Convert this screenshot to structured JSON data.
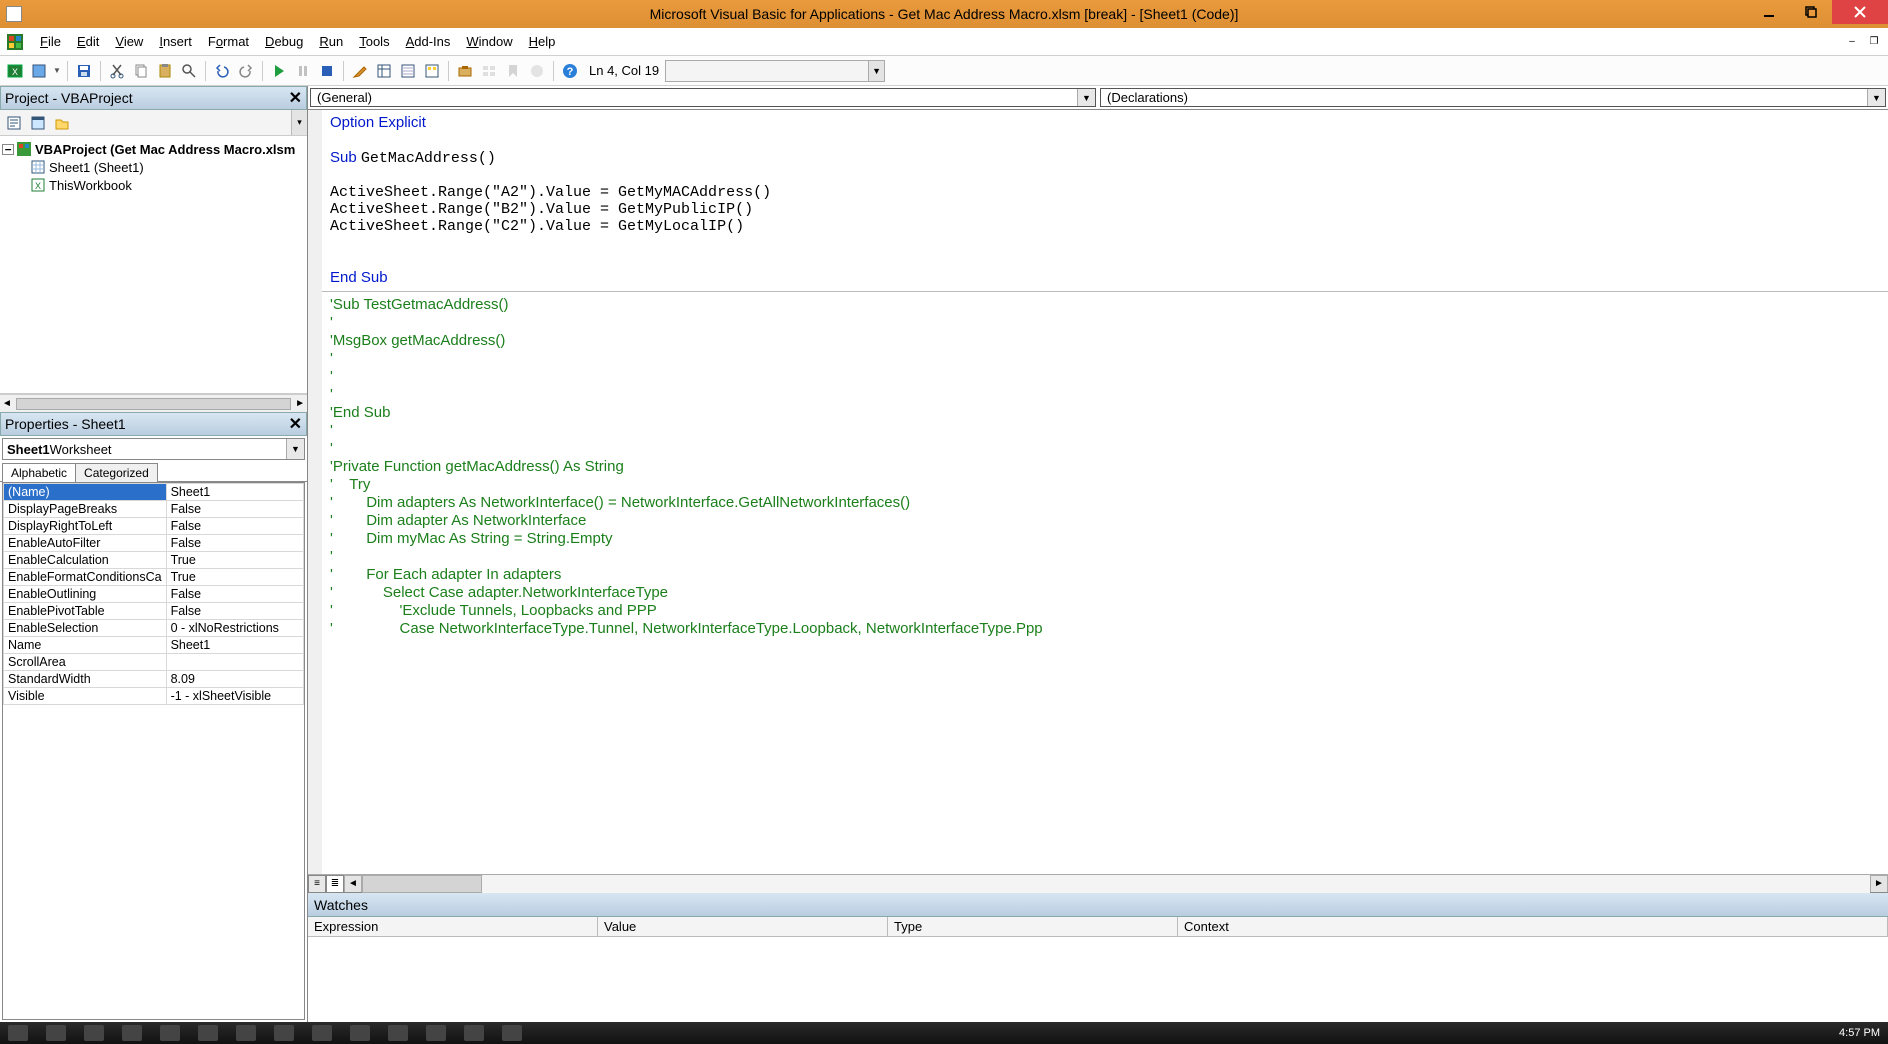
{
  "title": "Microsoft Visual Basic for Applications - Get Mac Address Macro.xlsm [break] - [Sheet1 (Code)]",
  "menu": {
    "file": "File",
    "edit": "Edit",
    "view": "View",
    "insert": "Insert",
    "format": "Format",
    "debug": "Debug",
    "run": "Run",
    "tools": "Tools",
    "addins": "Add-Ins",
    "window": "Window",
    "help": "Help"
  },
  "cursor_pos": "Ln 4, Col 19",
  "project": {
    "panel_title": "Project - VBAProject",
    "root": "VBAProject (Get Mac Address Macro.xlsm",
    "items": [
      "Sheet1 (Sheet1)",
      "ThisWorkbook"
    ]
  },
  "properties": {
    "panel_title": "Properties - Sheet1",
    "combo_bold": "Sheet1",
    "combo_rest": " Worksheet",
    "tabs": {
      "alpha": "Alphabetic",
      "cat": "Categorized"
    },
    "rows": [
      {
        "name": "(Name)",
        "value": "Sheet1",
        "sel": true
      },
      {
        "name": "DisplayPageBreaks",
        "value": "False"
      },
      {
        "name": "DisplayRightToLeft",
        "value": "False"
      },
      {
        "name": "EnableAutoFilter",
        "value": "False"
      },
      {
        "name": "EnableCalculation",
        "value": "True"
      },
      {
        "name": "EnableFormatConditionsCa",
        "value": "True"
      },
      {
        "name": "EnableOutlining",
        "value": "False"
      },
      {
        "name": "EnablePivotTable",
        "value": "False"
      },
      {
        "name": "EnableSelection",
        "value": "0 - xlNoRestrictions"
      },
      {
        "name": "Name",
        "value": "Sheet1"
      },
      {
        "name": "ScrollArea",
        "value": ""
      },
      {
        "name": "StandardWidth",
        "value": "8.09"
      },
      {
        "name": "Visible",
        "value": "-1 - xlSheetVisible"
      }
    ]
  },
  "code": {
    "object_combo": "(General)",
    "proc_combo": "(Declarations)",
    "lines": [
      {
        "t": "Option Explicit",
        "c": "kw"
      },
      {
        "t": "",
        "c": ""
      },
      {
        "seg": [
          {
            "t": "Sub ",
            "c": "kw"
          },
          {
            "t": "GetMacAddress()",
            "c": ""
          }
        ]
      },
      {
        "t": "",
        "c": ""
      },
      {
        "t": "ActiveSheet.Range(\"A2\").Value = GetMyMACAddress()",
        "c": ""
      },
      {
        "t": "ActiveSheet.Range(\"B2\").Value = GetMyPublicIP()",
        "c": ""
      },
      {
        "t": "ActiveSheet.Range(\"C2\").Value = GetMyLocalIP()",
        "c": ""
      },
      {
        "t": "",
        "c": ""
      },
      {
        "t": "",
        "c": ""
      },
      {
        "t": "End Sub",
        "c": "kw"
      },
      {
        "rule": true
      },
      {
        "t": "'Sub TestGetmacAddress()",
        "c": "cm"
      },
      {
        "t": "'",
        "c": "cm"
      },
      {
        "t": "'MsgBox getMacAddress()",
        "c": "cm"
      },
      {
        "t": "'",
        "c": "cm"
      },
      {
        "t": "'",
        "c": "cm"
      },
      {
        "t": "'",
        "c": "cm"
      },
      {
        "t": "'End Sub",
        "c": "cm"
      },
      {
        "t": "'",
        "c": "cm"
      },
      {
        "t": "'",
        "c": "cm"
      },
      {
        "t": "'Private Function getMacAddress() As String",
        "c": "cm"
      },
      {
        "t": "'    Try",
        "c": "cm"
      },
      {
        "t": "'        Dim adapters As NetworkInterface() = NetworkInterface.GetAllNetworkInterfaces()",
        "c": "cm"
      },
      {
        "t": "'        Dim adapter As NetworkInterface",
        "c": "cm"
      },
      {
        "t": "'        Dim myMac As String = String.Empty",
        "c": "cm"
      },
      {
        "t": "'",
        "c": "cm"
      },
      {
        "t": "'        For Each adapter In adapters",
        "c": "cm"
      },
      {
        "t": "'            Select Case adapter.NetworkInterfaceType",
        "c": "cm"
      },
      {
        "t": "'                'Exclude Tunnels, Loopbacks and PPP",
        "c": "cm"
      },
      {
        "t": "'                Case NetworkInterfaceType.Tunnel, NetworkInterfaceType.Loopback, NetworkInterfaceType.Ppp",
        "c": "cm"
      }
    ]
  },
  "watches": {
    "title": "Watches",
    "cols": {
      "expr": "Expression",
      "value": "Value",
      "type": "Type",
      "context": "Context"
    }
  },
  "taskbar": {
    "clock": "4:57 PM"
  }
}
